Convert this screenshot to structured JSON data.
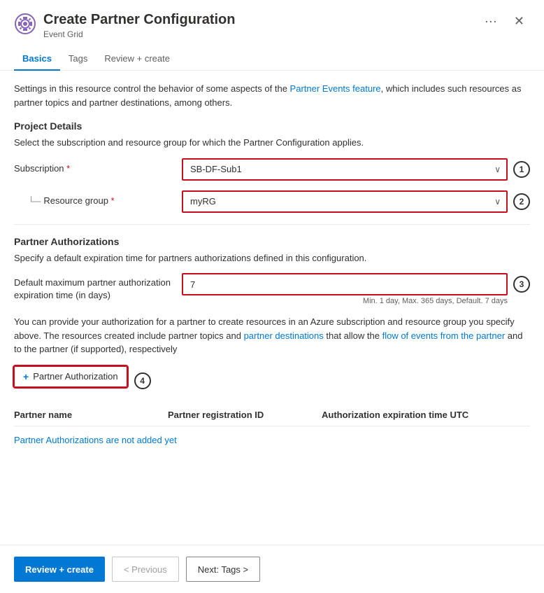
{
  "dialog": {
    "title": "Create Partner Configuration",
    "subtitle": "Event Grid",
    "ellipsis_label": "...",
    "close_label": "×"
  },
  "tabs": [
    {
      "id": "basics",
      "label": "Basics",
      "active": true
    },
    {
      "id": "tags",
      "label": "Tags",
      "active": false
    },
    {
      "id": "review",
      "label": "Review + create",
      "active": false
    }
  ],
  "basics": {
    "description": "Settings in this resource control the behavior of some aspects of the Partner Events feature, which includes such resources as partner topics and partner destinations, among others.",
    "project_details": {
      "title": "Project Details",
      "description": "Select the subscription and resource group for which the Partner Configuration applies.",
      "subscription_label": "Subscription",
      "subscription_value": "SB-DF-Sub1",
      "subscription_options": [
        "SB-DF-Sub1"
      ],
      "resource_group_label": "Resource group",
      "resource_group_value": "myRG",
      "resource_group_options": [
        "myRG"
      ],
      "step1_badge": "1",
      "step2_badge": "2"
    },
    "partner_authorizations": {
      "title": "Partner Authorizations",
      "description": "Specify a default expiration time for partners authorizations defined in this configuration.",
      "default_expiry_label": "Default maximum partner authorization expiration time (in days)",
      "default_expiry_value": "7",
      "expiry_hint": "Min. 1 day, Max. 365 days, Default. 7 days",
      "step3_badge": "3",
      "info_text": "You can provide your authorization for a partner to create resources in an Azure subscription and resource group you specify above. The resources created include partner topics and partner destinations that allow the flow of events from the partner and to the partner (if supported), respectively",
      "add_partner_label": "Partner Authorization",
      "step4_badge": "4",
      "table_columns": [
        "Partner name",
        "Partner registration ID",
        "Authorization expiration time UTC"
      ],
      "empty_message": "Partner Authorizations are not added yet"
    }
  },
  "footer": {
    "review_create_label": "Review + create",
    "previous_label": "< Previous",
    "next_label": "Next: Tags >"
  },
  "icons": {
    "gear": "⚙",
    "plus": "+",
    "chevron_down": "⌄",
    "ellipsis": "···",
    "close": "✕"
  }
}
